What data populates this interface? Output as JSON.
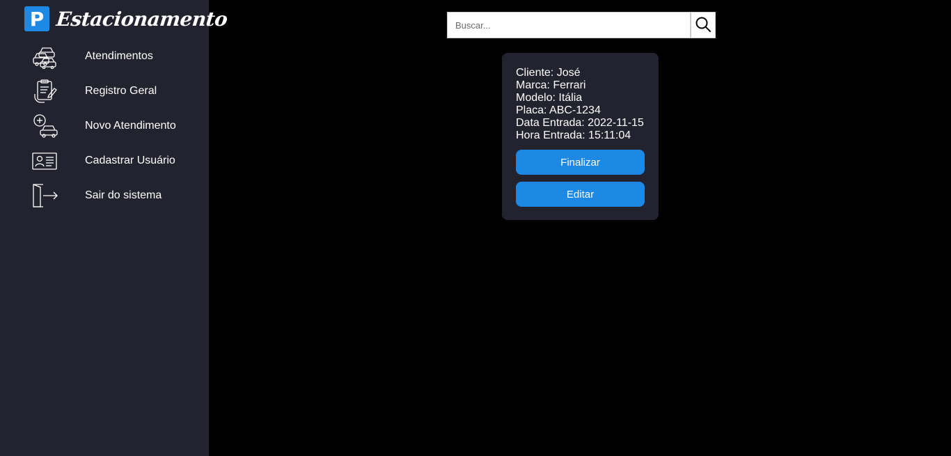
{
  "brand": {
    "logo_letter": "P",
    "name": "Estacionamento"
  },
  "nav": {
    "items": [
      {
        "label": "Atendimentos",
        "icon": "cars-icon"
      },
      {
        "label": "Registro Geral",
        "icon": "clipboard-edit-icon"
      },
      {
        "label": "Novo Atendimento",
        "icon": "add-car-icon"
      },
      {
        "label": "Cadastrar Usuário",
        "icon": "id-card-icon"
      },
      {
        "label": "Sair do sistema",
        "icon": "exit-door-icon"
      }
    ]
  },
  "search": {
    "placeholder": "Buscar...",
    "value": "",
    "icon": "search-icon"
  },
  "card": {
    "cliente": "Cliente: José",
    "marca": "Marca: Ferrari",
    "modelo": "Modelo: Itália",
    "placa": "Placa: ABC-1234",
    "data_entrada": "Data Entrada: 2022-11-15",
    "hora_entrada": "Hora Entrada: 15:11:04",
    "finalizar_label": "Finalizar",
    "editar_label": "Editar"
  },
  "colors": {
    "sidebar_bg": "#22232e",
    "page_bg": "#000000",
    "accent": "#1e88e5",
    "text": "#ffffff"
  }
}
